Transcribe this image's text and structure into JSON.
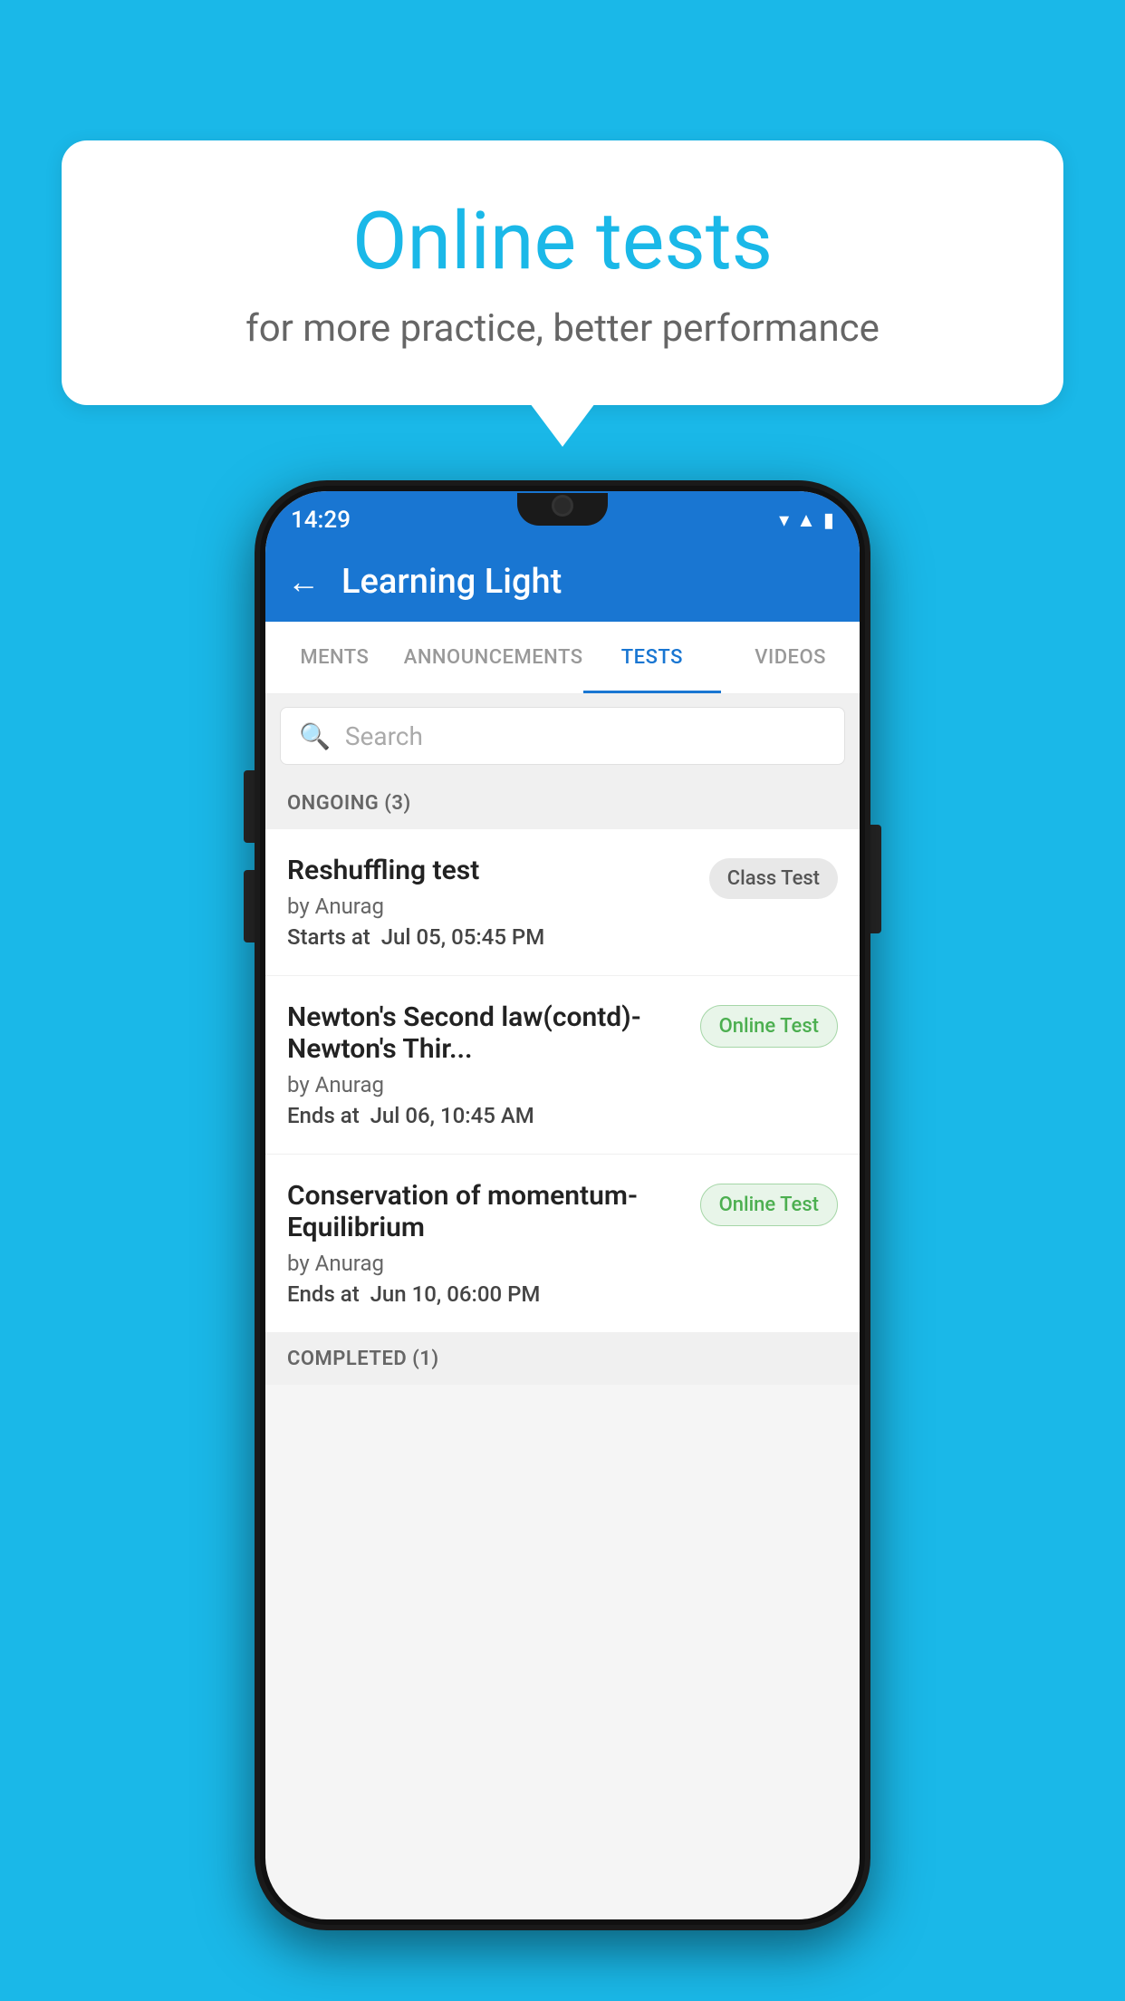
{
  "background_color": "#1ab8e8",
  "speech_bubble": {
    "title": "Online tests",
    "subtitle": "for more practice, better performance"
  },
  "status_bar": {
    "time": "14:29",
    "icons": [
      "wifi",
      "signal",
      "battery"
    ]
  },
  "app_bar": {
    "title": "Learning Light",
    "back_label": "←"
  },
  "tabs": [
    {
      "label": "MENTS",
      "active": false
    },
    {
      "label": "ANNOUNCEMENTS",
      "active": false
    },
    {
      "label": "TESTS",
      "active": true
    },
    {
      "label": "VIDEOS",
      "active": false
    }
  ],
  "search": {
    "placeholder": "Search"
  },
  "ongoing_section": {
    "label": "ONGOING (3)"
  },
  "tests": [
    {
      "name": "Reshuffling test",
      "author": "by Anurag",
      "date_label": "Starts at",
      "date": "Jul 05, 05:45 PM",
      "badge": "Class Test",
      "badge_type": "class"
    },
    {
      "name": "Newton's Second law(contd)-Newton's Thir...",
      "author": "by Anurag",
      "date_label": "Ends at",
      "date": "Jul 06, 10:45 AM",
      "badge": "Online Test",
      "badge_type": "online"
    },
    {
      "name": "Conservation of momentum-Equilibrium",
      "author": "by Anurag",
      "date_label": "Ends at",
      "date": "Jun 10, 06:00 PM",
      "badge": "Online Test",
      "badge_type": "online"
    }
  ],
  "completed_section": {
    "label": "COMPLETED (1)"
  }
}
